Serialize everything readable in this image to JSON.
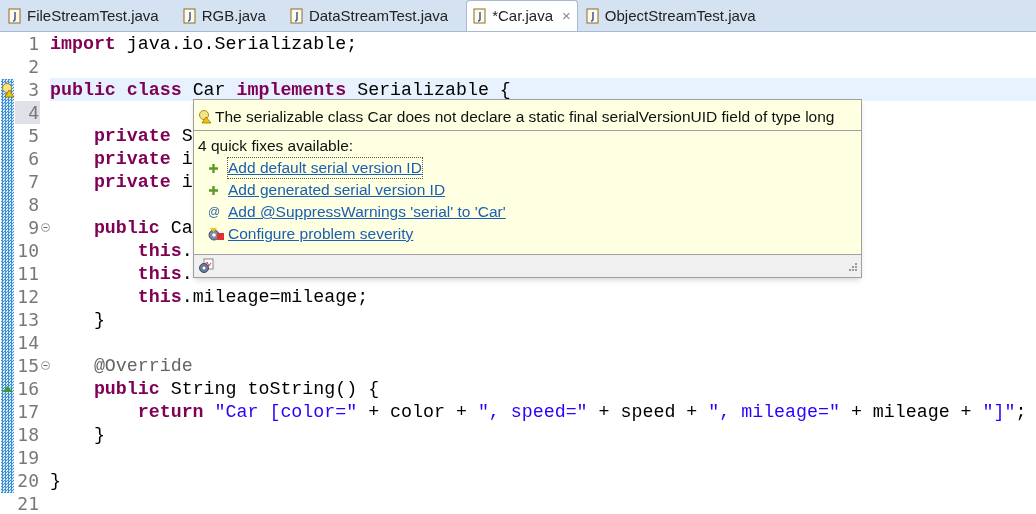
{
  "tabs": [
    {
      "label": "FileStreamTest.java",
      "selected": false
    },
    {
      "label": "RGB.java",
      "selected": false
    },
    {
      "label": "DataStreamTest.java",
      "selected": false
    },
    {
      "label": "*Car.java",
      "selected": true,
      "close": "×"
    },
    {
      "label": "ObjectStreamTest.java",
      "selected": false
    }
  ],
  "editor": {
    "lines": [
      {
        "number": "1",
        "tokens": [
          {
            "kind": "keyword",
            "text": "import"
          },
          {
            "kind": "plain",
            "text": " java.io.Serializable;"
          }
        ]
      },
      {
        "number": "2",
        "kind": "plain"
      },
      {
        "number": "3",
        "current": true,
        "kind": "warning",
        "tokens": [
          {
            "kind": "keyword",
            "text": "public class"
          },
          {
            "kind": "plain",
            "text": " Car "
          },
          {
            "kind": "keyword",
            "text": "implements"
          },
          {
            "kind": "plain",
            "text": " Serializable {"
          }
        ]
      },
      {
        "number": "4",
        "kind": "plain"
      },
      {
        "number": "5",
        "tokens": [
          {
            "kind": "keyword",
            "text": "    private"
          },
          {
            "kind": "plain",
            "text": " S"
          }
        ]
      },
      {
        "number": "6",
        "tokens": [
          {
            "kind": "keyword",
            "text": "    private"
          },
          {
            "kind": "plain",
            "text": " i"
          }
        ]
      },
      {
        "number": "7",
        "tokens": [
          {
            "kind": "keyword",
            "text": "    private"
          },
          {
            "kind": "plain",
            "text": " i"
          }
        ]
      },
      {
        "number": "8",
        "kind": "plain"
      },
      {
        "number": "9",
        "kind": "fold",
        "tokens": [
          {
            "kind": "keyword",
            "text": "    public"
          },
          {
            "kind": "plain",
            "text": " Ca"
          }
        ]
      },
      {
        "number": "10",
        "tokens": [
          {
            "kind": "keyword",
            "text": "        this"
          },
          {
            "kind": "plain",
            "text": "."
          }
        ]
      },
      {
        "number": "11",
        "tokens": [
          {
            "kind": "keyword",
            "text": "        this"
          },
          {
            "kind": "plain",
            "text": "."
          }
        ]
      },
      {
        "number": "12",
        "tokens": [
          {
            "kind": "keyword",
            "text": "        this"
          },
          {
            "kind": "plain",
            "text": ".mileage=mileage;"
          }
        ]
      },
      {
        "number": "13",
        "tokens": [
          {
            "kind": "plain",
            "text": "    }"
          }
        ]
      },
      {
        "number": "14",
        "kind": "plain"
      },
      {
        "number": "15",
        "kind": "fold",
        "tokens": [
          {
            "kind": "annotation",
            "text": "    @Override"
          }
        ]
      },
      {
        "number": "16",
        "kind": "override",
        "tokens": [
          {
            "kind": "keyword",
            "text": "    public"
          },
          {
            "kind": "plain",
            "text": " String toString() {"
          }
        ]
      },
      {
        "number": "17",
        "tokens": [
          {
            "kind": "keyword",
            "text": "        return"
          },
          {
            "kind": "string",
            "text": " \"Car [color=\""
          },
          {
            "kind": "plain",
            "text": " + color + "
          },
          {
            "kind": "string",
            "text": "\", speed=\""
          },
          {
            "kind": "plain",
            "text": " + speed + "
          },
          {
            "kind": "string",
            "text": "\", mileage=\""
          },
          {
            "kind": "plain",
            "text": " + mileage + "
          },
          {
            "kind": "string",
            "text": "\"]\""
          },
          {
            "kind": "plain",
            "text": ";"
          }
        ]
      },
      {
        "number": "18",
        "tokens": [
          {
            "kind": "plain",
            "text": "    }"
          }
        ]
      },
      {
        "number": "19",
        "kind": "plain"
      },
      {
        "number": "20",
        "tokens": [
          {
            "kind": "plain",
            "text": "}"
          }
        ]
      },
      {
        "number": "21",
        "kind": "plain"
      }
    ]
  },
  "popup": {
    "message": "The serializable class Car does not declare a static final serialVersionUID field of type long",
    "summary": "4 quick fixes available:",
    "fixes": [
      {
        "kind": "add",
        "label": "Add default serial version ID",
        "selected": true
      },
      {
        "kind": "add",
        "label": "Add generated serial version ID",
        "selected": false
      },
      {
        "kind": "annotation",
        "icon": "@",
        "label": "Add @SuppressWarnings 'serial' to 'Car'",
        "selected": false
      },
      {
        "kind": "configure",
        "label": "Configure problem severity",
        "selected": false
      }
    ]
  }
}
